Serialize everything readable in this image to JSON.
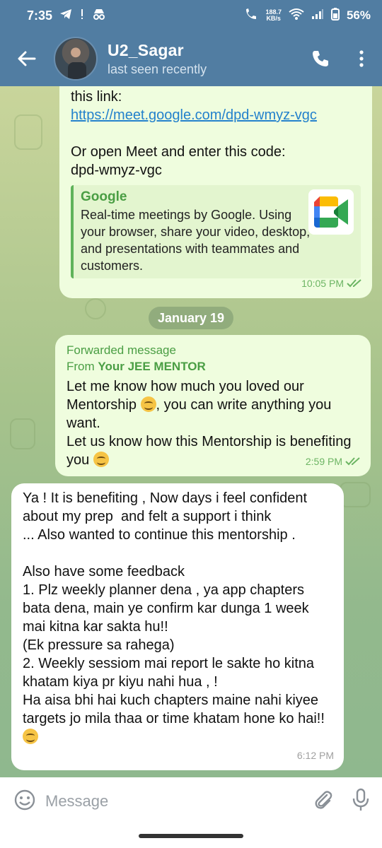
{
  "status_bar": {
    "time": "7:35",
    "net_speed_value": "188.7",
    "net_speed_unit": "KB/s",
    "battery": "56%"
  },
  "header": {
    "name": "U2_Sagar",
    "status": "last seen recently"
  },
  "messages": {
    "m1": {
      "lines": [
        "this link:"
      ],
      "link": "https://meet.google.com/dpd-wmyz-vgc",
      "line3": "Or open Meet and enter this code:",
      "line4": "dpd-wmyz-vgc",
      "preview_site": "Google",
      "preview_desc": "Real-time meetings by Google. Using your browser, share your video, desktop, and presentations with teammates and customers.",
      "time": "10:05 PM"
    },
    "date_divider": "January 19",
    "m2": {
      "fwd_label": "Forwarded message",
      "fwd_from_prefix": "From ",
      "fwd_from": "Your JEE MENTOR",
      "text_a": "Let me know how much you loved our Mentorship ",
      "text_b": ", you can write anything you want.",
      "text_c": "Let us know how this Mentorship is benefiting you ",
      "time": "2:59 PM"
    },
    "m3": {
      "text": "Ya ! It is benefiting , Now days i feel confident  about my prep  and felt a support i think\n... Also wanted to continue this mentorship .\n\nAlso have some feedback\n1. Plz weekly planner dena , ya app chapters bata dena, main ye confirm kar dunga 1 week mai kitna kar sakta hu!!\n(Ek pressure sa rahega)\n2. Weekly sessiom mai report le sakte ho kitna khatam kiya pr kiyu nahi hua , !\nHa aisa bhi hai kuch chapters maine nahi kiyee targets jo mila thaa or time khatam hone ko hai!!",
      "time": "6:12 PM"
    }
  },
  "input": {
    "placeholder": "Message"
  },
  "colors": {
    "header": "#517da2",
    "outgoing_bubble": "#effdde",
    "incoming_bubble": "#ffffff",
    "accent_green": "#4a9e44",
    "link": "#2481cc"
  }
}
